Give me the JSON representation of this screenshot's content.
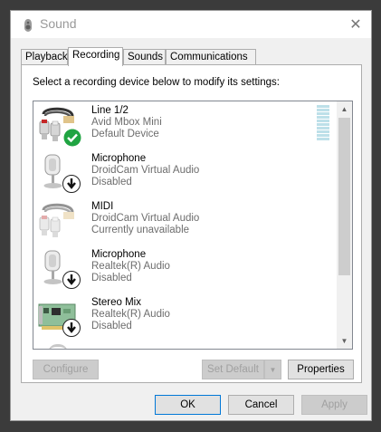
{
  "window": {
    "title": "Sound",
    "title_icon": "speaker-icon",
    "close_glyph": "✕"
  },
  "tabs": [
    {
      "label": "Playback",
      "active": false
    },
    {
      "label": "Recording",
      "active": true
    },
    {
      "label": "Sounds",
      "active": false
    },
    {
      "label": "Communications",
      "active": false
    }
  ],
  "recording": {
    "instruction": "Select a recording device below to modify its settings:",
    "devices": [
      {
        "name": "Line 1/2",
        "driver": "Avid Mbox Mini",
        "status": "Default Device",
        "icon": "line-in-cable-icon",
        "badge": "default-check-icon",
        "selected": false
      },
      {
        "name": "Microphone",
        "driver": "DroidCam Virtual Audio",
        "status": "Disabled",
        "icon": "microphone-icon",
        "badge": "disabled-arrow-icon",
        "selected": false
      },
      {
        "name": "MIDI",
        "driver": "DroidCam Virtual Audio",
        "status": "Currently unavailable",
        "icon": "line-in-cable-icon",
        "badge": "none",
        "selected": false
      },
      {
        "name": "Microphone",
        "driver": "Realtek(R) Audio",
        "status": "Disabled",
        "icon": "microphone-icon",
        "badge": "disabled-arrow-icon",
        "selected": false
      },
      {
        "name": "Stereo Mix",
        "driver": "Realtek(R) Audio",
        "status": "Disabled",
        "icon": "sound-card-icon",
        "badge": "disabled-arrow-icon",
        "selected": false
      }
    ],
    "level_meter_level": 0
  },
  "buttons": {
    "configure": "Configure",
    "set_default": "Set Default",
    "properties": "Properties",
    "ok": "OK",
    "cancel": "Cancel",
    "apply": "Apply"
  },
  "colors": {
    "accent": "#0078d7",
    "check_badge": "#20a442",
    "level_meter": "#bde0e9"
  }
}
